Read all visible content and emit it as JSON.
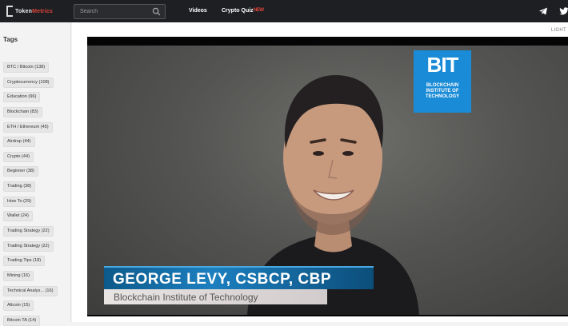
{
  "header": {
    "logo_text": "Token",
    "logo_text_accent": "Metrics",
    "search_placeholder": "Search",
    "nav": [
      {
        "label": "Videos"
      },
      {
        "label": "Crypto Quiz"
      }
    ],
    "quiz_badge": "NEW"
  },
  "sidebar": {
    "title": "Tags",
    "tags": [
      "BTC / Bitcoin (138)",
      "Cryptocurrency (108)",
      "Education (96)",
      "Blockchain (83)",
      "ETH / Ethereum (45)",
      "Airdrop (44)",
      "Crypto (44)",
      "Beginner (38)",
      "Trading (38)",
      "How To (29)",
      "Wallet (24)",
      "Trading Strategy (22)",
      "Trading Strategy (22)",
      "Trading Tips (18)",
      "Mining (16)",
      "Technical Analys... (16)",
      "Altcoin (15)",
      "Bitcoin TA (14)"
    ]
  },
  "main": {
    "theme_toggle": "LIGHT",
    "video": {
      "logo_word": "BIT",
      "logo_sub_1": "BLOCKCHAIN",
      "logo_sub_2": "INSTITUTE OF",
      "logo_sub_3": "TECHNOLOGY",
      "speaker_name": "GEORGE LEVY, CSBCP, CBP",
      "speaker_org": "Blockchain Institute of Technology"
    }
  },
  "colors": {
    "topbar": "#1d1f22",
    "accent_red": "#e0443a",
    "bit_blue": "#1a8bd6",
    "lower_third_blue": "#1c7fbf"
  }
}
